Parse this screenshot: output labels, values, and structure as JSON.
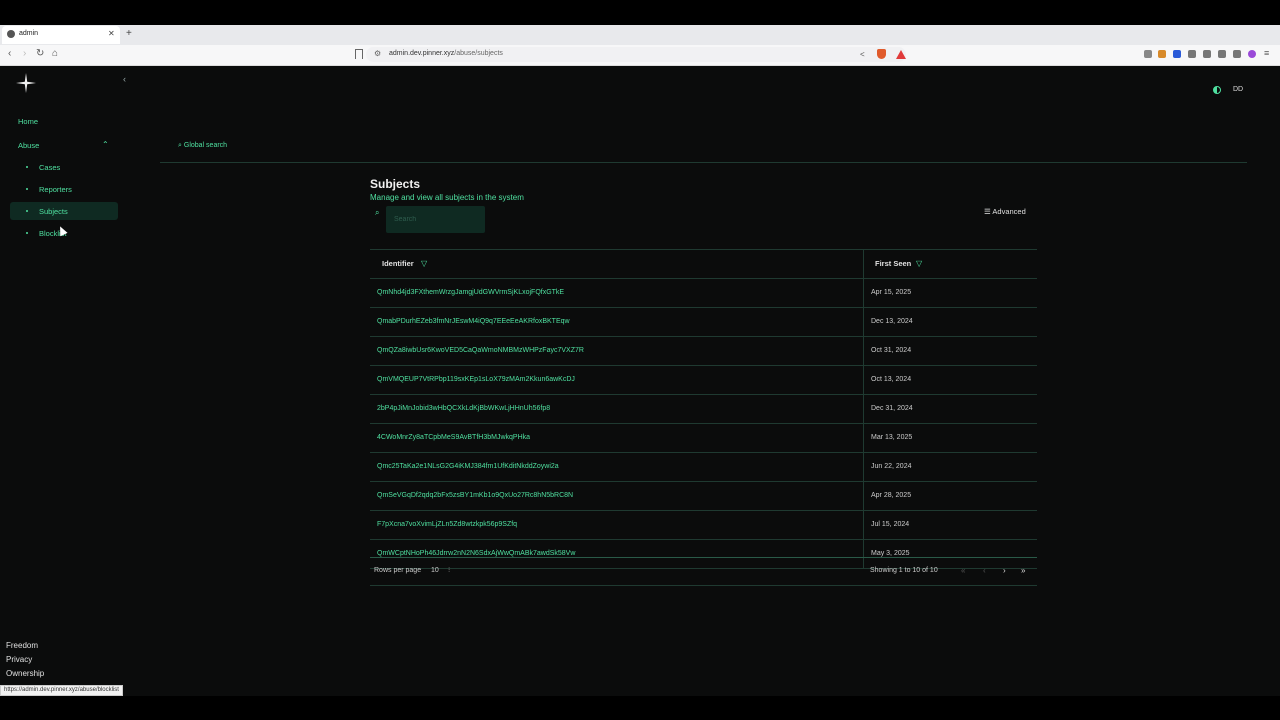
{
  "browser": {
    "tab_title": "admin",
    "url_host": "admin.dev.pinner.xyz",
    "url_path": "/abuse/subjects",
    "status_url": "https://admin.dev.pinner.xyz/abuse/blocklist"
  },
  "sidebar": {
    "home": "Home",
    "abuse": "Abuse",
    "items": [
      "Cases",
      "Reporters",
      "Subjects",
      "Blocklist"
    ],
    "active": "Subjects",
    "footer": [
      "Freedom",
      "Privacy",
      "Ownership"
    ]
  },
  "header": {
    "global_search": "Global search",
    "avatar": "DD"
  },
  "main": {
    "title": "Subjects",
    "subtitle": "Manage and view all subjects in the system",
    "search_placeholder": "Search",
    "advanced_label": "Advanced",
    "columns": [
      "Identifier",
      "First Seen"
    ],
    "rows": [
      {
        "id": "QmNhd4jd3FXthemWrzgJamgjUdGWVrmSjKLxojFQfxGTkE",
        "first_seen": "Apr 15, 2025"
      },
      {
        "id": "QmabPDurhEZeb3fmNrJEswM4iQ9q7EEeEeAKRfoxBKTEqw",
        "first_seen": "Dec 13, 2024"
      },
      {
        "id": "QmQZa8iwbUsr6KwoVED5CaQaWmoNMBMzWHPzFayc7VXZ7R",
        "first_seen": "Oct 31, 2024"
      },
      {
        "id": "QmVMQEUP7VtRPbp119sxKEp1sLoX79zMAm2Kkun6awKcDJ",
        "first_seen": "Oct 13, 2024"
      },
      {
        "id": "2bP4pJiMnJobid3wHbQCXkLdKjBbWKwLjHHnUh56fp8",
        "first_seen": "Dec 31, 2024"
      },
      {
        "id": "4CWoMnrZy8aTCpbMeS9AvBTfH3bMJwkqPHka",
        "first_seen": "Mar 13, 2025"
      },
      {
        "id": "Qmc25TaKa2e1NLsG2G4iKMJ384fm1UfKditNkddZoywi2a",
        "first_seen": "Jun 22, 2024"
      },
      {
        "id": "QmSeVGqDf2qdq2bFx5zsBY1mKb1o9QxUo27Rc8hN5bRC8N",
        "first_seen": "Apr 28, 2025"
      },
      {
        "id": "F7pXcna7voXvimLjZLn5Zd8wtzkpk56p9SZfq",
        "first_seen": "Jul 15, 2024"
      },
      {
        "id": "QmWCptNHoPh46Jdrrw2nN2N6SdxAjWwQmABk7awdSk58Vw",
        "first_seen": "May 3, 2025"
      }
    ],
    "rows_per_page_label": "Rows per page",
    "rows_per_page_value": "10",
    "showing_text": "Showing 1 to 10 of 10"
  },
  "colors": {
    "accent": "#4fe0a0",
    "background": "#0b0c0c",
    "border": "#1f3a31"
  }
}
